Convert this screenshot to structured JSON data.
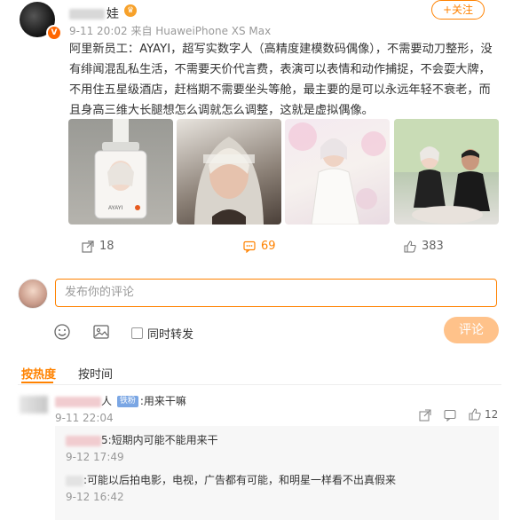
{
  "post": {
    "username_suffix": "娃",
    "vip_badge": "♛",
    "verified_badge": "V",
    "meta": "9-11 20:02 来自 HuaweiPhone XS Max",
    "follow_label": "+关注",
    "text": "阿里新员工：AYAYI，超写实数字人（高精度建模数码偶像），不需要动刀整形，没有绯闻混乱私生活，不需要天价代言费，表演可以表情和动作捕捉，不会耍大牌，不用住五星级酒店，赶档期不需要坐头等舱，最主要的是可以永远年轻不衰老，而且身高三维大长腿想怎么调就怎么调整，这就是虚拟偶像。",
    "images": [
      {
        "name": "photo-badge"
      },
      {
        "name": "photo-portrait"
      },
      {
        "name": "photo-white-suit"
      },
      {
        "name": "photo-with-man"
      }
    ],
    "image1_caption": "AYAYI",
    "actions": {
      "repost_count": "18",
      "comment_count": "69",
      "like_count": "383"
    }
  },
  "composer": {
    "placeholder": "发布你的评论",
    "repost_label": "同时转发",
    "submit_label": "评论"
  },
  "sort": {
    "hot": "按热度",
    "time": "按时间"
  },
  "comments": [
    {
      "name_tail": "人",
      "badge": "铁粉",
      "text": ":用来干嘛",
      "time": "9-11 22:04",
      "like_count": "12"
    }
  ],
  "replies": [
    {
      "name_tail": "5",
      "text": ":短期内可能不能用来干",
      "time": "9-12 17:49"
    },
    {
      "name_tail": "",
      "text": ":可能以后拍电影，电视，广告都有可能，和明星一样看不出真假来",
      "time": "9-12 16:42"
    }
  ],
  "colors": {
    "accent": "#ff8200",
    "submit_disabled": "#ffc28a",
    "comment_count": "#ff8200"
  }
}
